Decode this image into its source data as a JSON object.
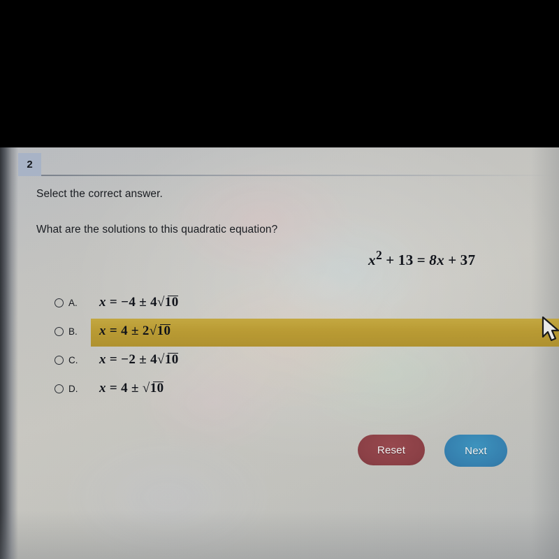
{
  "photo": {
    "letterbox_color": "#000000",
    "screen_bg_color": "#c4c4c0"
  },
  "header": {
    "question_number": "2"
  },
  "content": {
    "prompt": "Select the correct answer.",
    "question": "What are the solutions to this quadratic equation?",
    "equation": {
      "lhs_var": "x",
      "lhs_exp": "2",
      "lhs_plus": "+",
      "lhs_const": "13",
      "equals": "=",
      "rhs_coef_var": "8x",
      "rhs_plus": "+",
      "rhs_const": "37",
      "plain": "x2 + 13 = 8x + 37"
    }
  },
  "options": [
    {
      "id": "A",
      "letter": "A.",
      "selected": false,
      "highlighted": false,
      "var": "x",
      "equals": "=",
      "value": "−4",
      "pm": "±",
      "coef": "4",
      "radicand": "10",
      "plain": "x = −4 ± 4√10"
    },
    {
      "id": "B",
      "letter": "B.",
      "selected": false,
      "highlighted": true,
      "var": "x",
      "equals": "=",
      "value": "4",
      "pm": "±",
      "coef": "2",
      "radicand": "10",
      "plain": "x = 4 ± 2√10"
    },
    {
      "id": "C",
      "letter": "C.",
      "selected": false,
      "highlighted": false,
      "var": "x",
      "equals": "=",
      "value": "−2",
      "pm": "±",
      "coef": "4",
      "radicand": "10",
      "plain": "x = −2 ± 4√10"
    },
    {
      "id": "D",
      "letter": "D.",
      "selected": false,
      "highlighted": false,
      "var": "x",
      "equals": "=",
      "value": "4",
      "pm": "±",
      "coef": "",
      "radicand": "10",
      "plain": "x = 4 ± √10"
    }
  ],
  "highlight": {
    "color": "#b8982c"
  },
  "buttons": {
    "reset": {
      "label": "Reset",
      "color": "#8b4046"
    },
    "next": {
      "label": "Next",
      "color": "#357fae"
    }
  },
  "cursor": {
    "icon": "mouse-pointer-icon"
  }
}
